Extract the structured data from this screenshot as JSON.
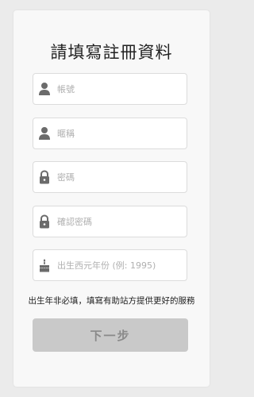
{
  "title": "請填寫註冊資料",
  "fields": [
    {
      "icon": "user-icon",
      "placeholder": "帳號",
      "value": ""
    },
    {
      "icon": "user-icon",
      "placeholder": "暱稱",
      "value": ""
    },
    {
      "icon": "lock-icon",
      "placeholder": "密碼",
      "value": ""
    },
    {
      "icon": "lock-icon",
      "placeholder": "確認密碼",
      "value": ""
    },
    {
      "icon": "cake-icon",
      "placeholder": "出生西元年份 (例: 1995)",
      "value": ""
    }
  ],
  "note": "出生年非必填，填寫有助站方提供更好的服務",
  "next_button": "下一步",
  "colors": {
    "icon": "#6b6b6b",
    "button_bg": "#c9c9c9",
    "button_text": "#8a8a8a"
  }
}
